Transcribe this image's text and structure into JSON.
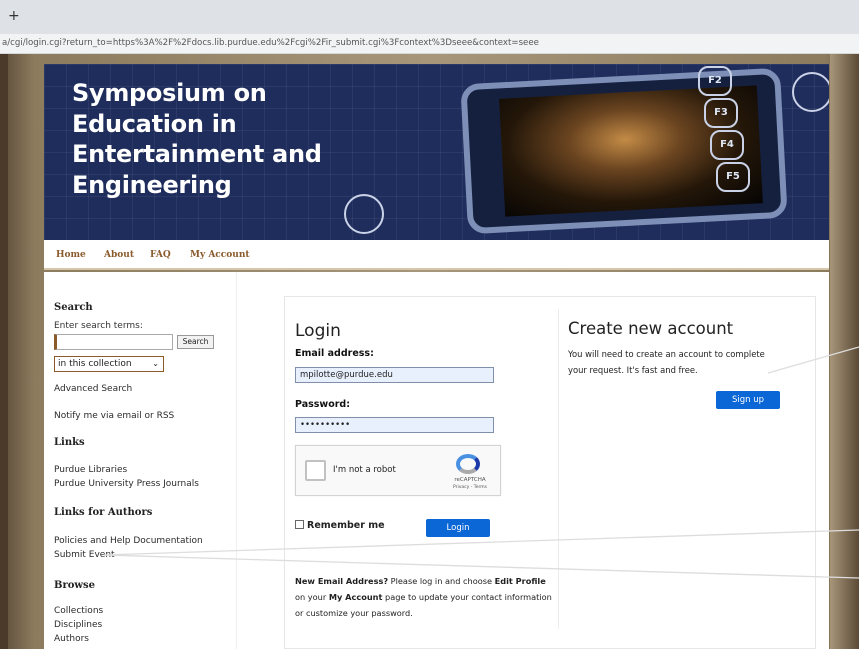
{
  "browser": {
    "new_tab_glyph": "+",
    "url": "a/cgi/login.cgi?return_to=https%3A%2F%2Fdocs.lib.purdue.edu%2Fcgi%2Fir_submit.cgi%3Fcontext%3Dseee&context=seee"
  },
  "banner": {
    "title_line1": "Symposium on",
    "title_line2": "Education in",
    "title_line3": "Entertainment and",
    "title_line4": "Engineering",
    "fkeys": [
      "F2",
      "F3",
      "F4",
      "F5"
    ]
  },
  "nav": {
    "home": "Home",
    "about": "About",
    "faq": "FAQ",
    "my_account": "My Account"
  },
  "sidebar": {
    "search_heading": "Search",
    "search_prompt": "Enter search terms:",
    "search_value": "",
    "search_button": "Search",
    "scope_selected": "in this collection",
    "advanced_search": "Advanced Search",
    "notify": "Notify me via email or RSS",
    "links_heading": "Links",
    "links": [
      "Purdue Libraries",
      "Purdue University Press Journals"
    ],
    "authors_heading": "Links for Authors",
    "author_links": [
      "Policies and Help Documentation",
      "Submit Event"
    ],
    "browse_heading": "Browse",
    "browse_links": [
      "Collections",
      "Disciplines",
      "Authors"
    ]
  },
  "login": {
    "heading": "Login",
    "email_label": "Email address:",
    "email_value": "mpilotte@purdue.edu",
    "password_label": "Password:",
    "password_value": "••••••••••",
    "captcha_label": "I'm not a robot",
    "captcha_brand": "reCAPTCHA",
    "captcha_terms": "Privacy - Terms",
    "remember_label": "Remember me",
    "login_button": "Login",
    "help_prefix": "New Email Address?",
    "help_text_1": " Please log in and choose ",
    "help_edit_profile": "Edit Profile",
    "help_text_2": " on your ",
    "help_my_account": "My Account",
    "help_text_3": " page to update your contact information or customize your password."
  },
  "create_account": {
    "heading": "Create new account",
    "description": "You will need to create an account to complete your request. It's fast and free.",
    "signup_button": "Sign up"
  },
  "colors": {
    "banner_navy": "#1f2d5c",
    "nav_link": "#8a5a2b",
    "button_blue": "#0b67d6"
  }
}
